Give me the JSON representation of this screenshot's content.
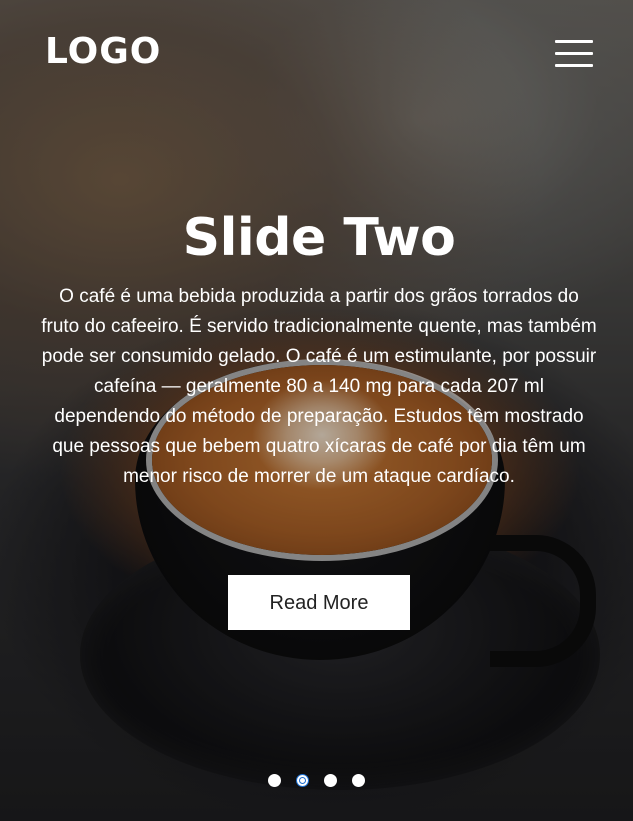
{
  "header": {
    "logo_text": "LOGO",
    "menu_icon": "hamburger-menu-icon"
  },
  "slide": {
    "title": "Slide Two",
    "text": "O café é uma bebida produzida a partir dos grãos torrados do fruto do cafeeiro. É servido tradicionalmente quente, mas também pode ser consumido gelado. O café é um estimulante, por possuir cafeína — geralmente 80 a 140 mg para cada 207 ml dependendo do método de preparação. Estudos têm mostrado que pessoas que bebem quatro xícaras de café por dia têm um menor risco de morrer de um ataque cardíaco.",
    "button_label": "Read More"
  },
  "carousel": {
    "slide_count": 4,
    "active_index": 1
  },
  "colors": {
    "button_background": "#ffffff",
    "button_text": "#222222",
    "active_dot_accent": "#1d6fd0",
    "text": "#ffffff"
  }
}
